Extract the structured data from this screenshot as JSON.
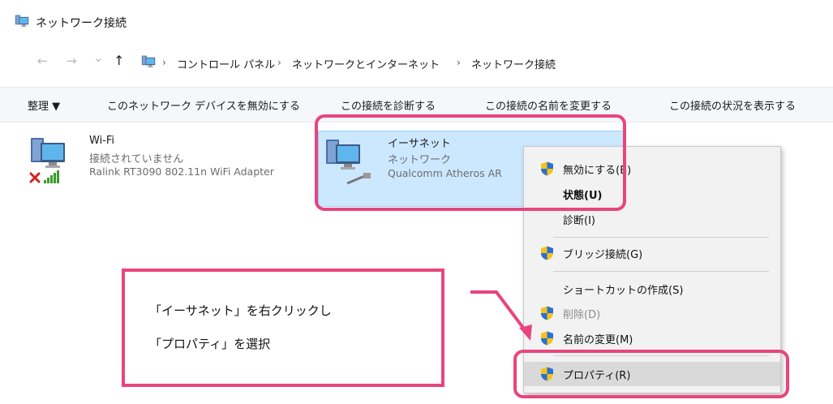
{
  "window": {
    "title": "ネットワーク接続",
    "icon": "network-connections-icon"
  },
  "address": {
    "nav": {
      "back": "←",
      "forward": "→",
      "recent": "⌄",
      "up": "↑"
    },
    "separator": "›",
    "crumbs": [
      "コントロール パネル",
      "ネットワークとインターネット",
      "ネットワーク接続"
    ]
  },
  "commands": {
    "organize": "整理 ▼",
    "disable": "このネットワーク デバイスを無効にする",
    "diagnose": "この接続を診断する",
    "rename": "この接続の名前を変更する",
    "status": "この接続の状況を表示する"
  },
  "connections": [
    {
      "name": "Wi-Fi",
      "status": "接続されていません",
      "adapter": "Ralink RT3090 802.11n WiFi Adapter",
      "icon": "wifi-adapter-icon"
    },
    {
      "name": "イーサネット",
      "status": "ネットワーク",
      "adapter": "Qualcomm Atheros AR",
      "icon": "ethernet-adapter-icon"
    }
  ],
  "context_menu": {
    "items": [
      {
        "label": "無効にする(B)",
        "shield": true
      },
      {
        "label": "状態(U)",
        "bold": true
      },
      {
        "label": "診断(I)"
      },
      {
        "label": "ブリッジ接続(G)",
        "shield": true
      },
      {
        "label": "ショートカットの作成(S)"
      },
      {
        "label": "削除(D)",
        "shield": true,
        "disabled": true
      },
      {
        "label": "名前の変更(M)",
        "shield": true
      },
      {
        "label": "プロパティ(R)",
        "shield": true,
        "hover": true
      }
    ]
  },
  "callout": {
    "line1": "「イーサネット」を右クリックし",
    "line2": "「プロパティ」を選択"
  },
  "colors": {
    "highlight": "#e8457e",
    "selection": "#cce8ff",
    "menu_bg": "#f2f2f2"
  }
}
